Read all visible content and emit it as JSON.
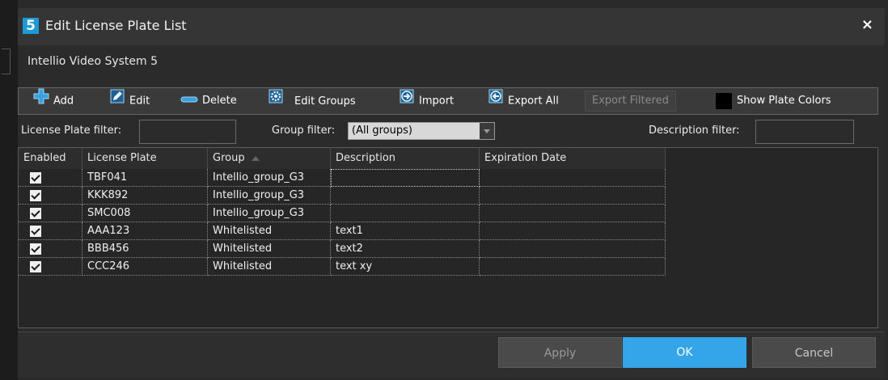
{
  "window": {
    "title": "Edit License Plate List",
    "app_icon_text": "5",
    "close_label": "×"
  },
  "subtitle": "Intellio Video System 5",
  "toolbar": {
    "add": "Add",
    "edit": "Edit",
    "delete": "Delete",
    "edit_groups": "Edit Groups",
    "import": "Import",
    "export_all": "Export All",
    "export_filtered": "Export Filtered",
    "show_plate_colors": "Show Plate Colors"
  },
  "filters": {
    "license_plate_label": "License Plate filter:",
    "license_plate_value": "",
    "group_label": "Group filter:",
    "group_value": "(All groups)",
    "description_label": "Description filter:",
    "description_value": ""
  },
  "table": {
    "columns": [
      "Enabled",
      "License Plate",
      "Group",
      "Description",
      "Expiration Date"
    ],
    "rows": [
      {
        "enabled": true,
        "plate": "TBF041",
        "group": "Intellio_group_G3",
        "description": "",
        "expiration": ""
      },
      {
        "enabled": true,
        "plate": "KKK892",
        "group": "Intellio_group_G3",
        "description": "",
        "expiration": ""
      },
      {
        "enabled": true,
        "plate": "SMC008",
        "group": "Intellio_group_G3",
        "description": "",
        "expiration": ""
      },
      {
        "enabled": true,
        "plate": "AAA123",
        "group": "Whitelisted",
        "description": "text1",
        "expiration": ""
      },
      {
        "enabled": true,
        "plate": "BBB456",
        "group": "Whitelisted",
        "description": "text2",
        "expiration": ""
      },
      {
        "enabled": true,
        "plate": "CCC246",
        "group": "Whitelisted",
        "description": "text xy",
        "expiration": ""
      }
    ]
  },
  "footer": {
    "apply": "Apply",
    "ok": "OK",
    "cancel": "Cancel"
  },
  "colors": {
    "accent": "#35a5ea",
    "background": "#2b2b2b",
    "titlebar": "#353535"
  }
}
